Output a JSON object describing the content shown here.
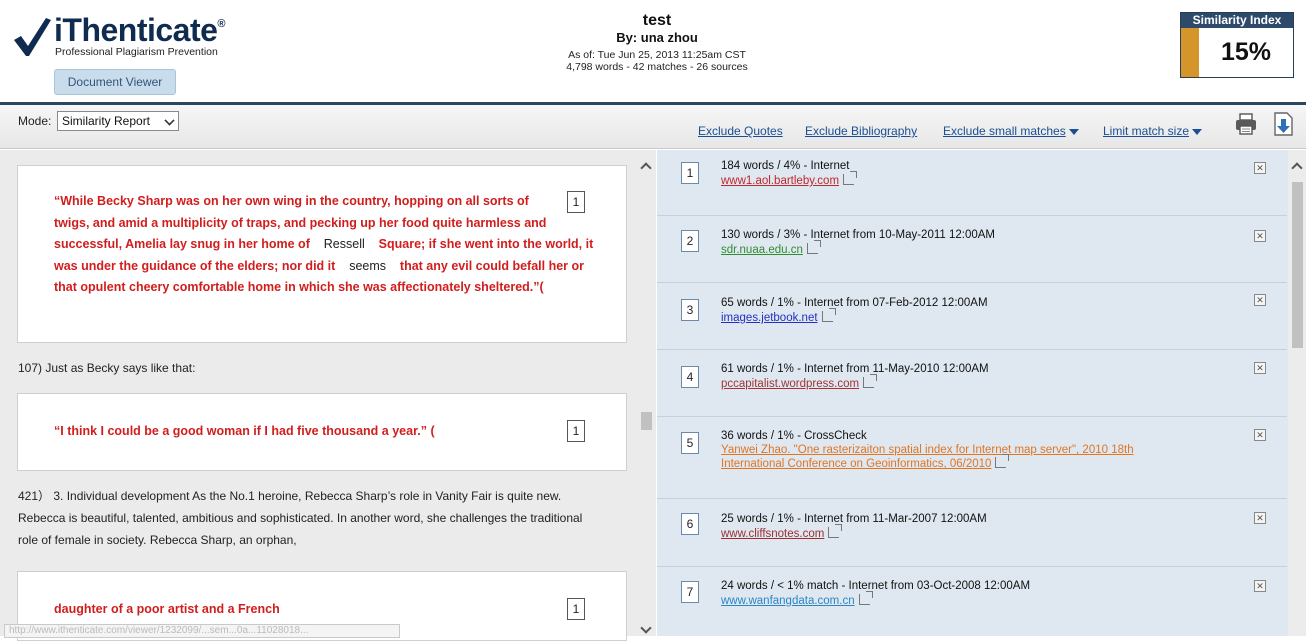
{
  "brand": {
    "name": "iThenticate",
    "registered": "®",
    "tagline": "Professional Plagiarism Prevention",
    "document_viewer_label": "Document Viewer"
  },
  "document": {
    "title": "test",
    "author": "By: una zhou",
    "as_of": "As of: Tue Jun 25, 2013 11:25am CST",
    "counts": "4,798 words - 42 matches - 26 sources"
  },
  "similarity": {
    "label": "Similarity Index",
    "value": "15%",
    "percent": 15,
    "bar_color": "#d4962a"
  },
  "toolbar": {
    "mode_label": "Mode:",
    "mode_value": "Similarity Report",
    "links": {
      "exclude_quotes": "Exclude Quotes",
      "exclude_bibliography": "Exclude Bibliography",
      "exclude_small": "Exclude small matches",
      "limit_match": "Limit match size"
    },
    "icons": [
      "print-icon",
      "download-icon"
    ]
  },
  "document_content": {
    "quote1": {
      "l1": "“While Becky Sharp was on her own wing in the country, hopping on all sorts of",
      "l2": "twigs, and amid a multiplicity of traps, and pecking up her food quite harmless and",
      "l3a": "successful, Amelia lay snug in her home of",
      "l3b": "Ressell",
      "l3c": "Square; if she went into the world, it",
      "l4a": "was under the guidance of the elders; nor did it",
      "l4b": "seems",
      "l4c": "that any evil could befall her or",
      "l5": "that opulent cheery comfortable home in which she was affectionately sheltered.”(",
      "match": "1"
    },
    "para1": "107) Just as Becky says like that:",
    "quote2": {
      "text": "“I think I could be a good woman if I had five thousand a year.” (",
      "match": "1"
    },
    "para2": {
      "l1": "421） 3. Individual development As the No.1 heroine, Rebecca Sharp’s role in Vanity Fair is quite new.",
      "l2": "Rebecca is beautiful, talented, ambitious and sophisticated. In another word, she challenges the traditional",
      "l3": "role of female in society. Rebecca Sharp, an orphan,"
    },
    "quote3": {
      "text": "daughter of a poor artist and a French",
      "match": "1"
    },
    "status_tip": "http://www.ithenticate.com/viewer/1232099/...sem...0a...11028018..."
  },
  "sources": [
    {
      "num": "1",
      "info": "184 words / 4% - Internet",
      "url": "www1.aol.bartleby.com",
      "url_color": "#c0262b"
    },
    {
      "num": "2",
      "info": "130 words / 3% - Internet from 10-May-2011 12:00AM",
      "url": "sdr.nuaa.edu.cn",
      "url_color": "#2f8d2f"
    },
    {
      "num": "3",
      "info": "65 words / 1% - Internet from 07-Feb-2012 12:00AM",
      "url": "images.jetbook.net",
      "url_color": "#2431c0"
    },
    {
      "num": "4",
      "info": "61 words / 1% - Internet from 11-May-2010 12:00AM",
      "url": "pccapitalist.wordpress.com",
      "url_color": "#a23434"
    },
    {
      "num": "5",
      "info": "36 words / 1% - CrossCheck",
      "url": "Yanwei Zhao. \"One rasterizaiton spatial index for Internet map server\", 2010 18th",
      "url2": "International Conference on Geoinformatics, 06/2010",
      "url_color": "#e07522"
    },
    {
      "num": "6",
      "info": "25 words / 1% - Internet from 11-Mar-2007 12:00AM",
      "url": "www.cliffsnotes.com",
      "url_color": "#9a2f2f"
    },
    {
      "num": "7",
      "info": "24 words / < 1% match - Internet from 03-Oct-2008 12:00AM",
      "url": "www.wanfangdata.com.cn",
      "url_color": "#2a86c4"
    }
  ]
}
